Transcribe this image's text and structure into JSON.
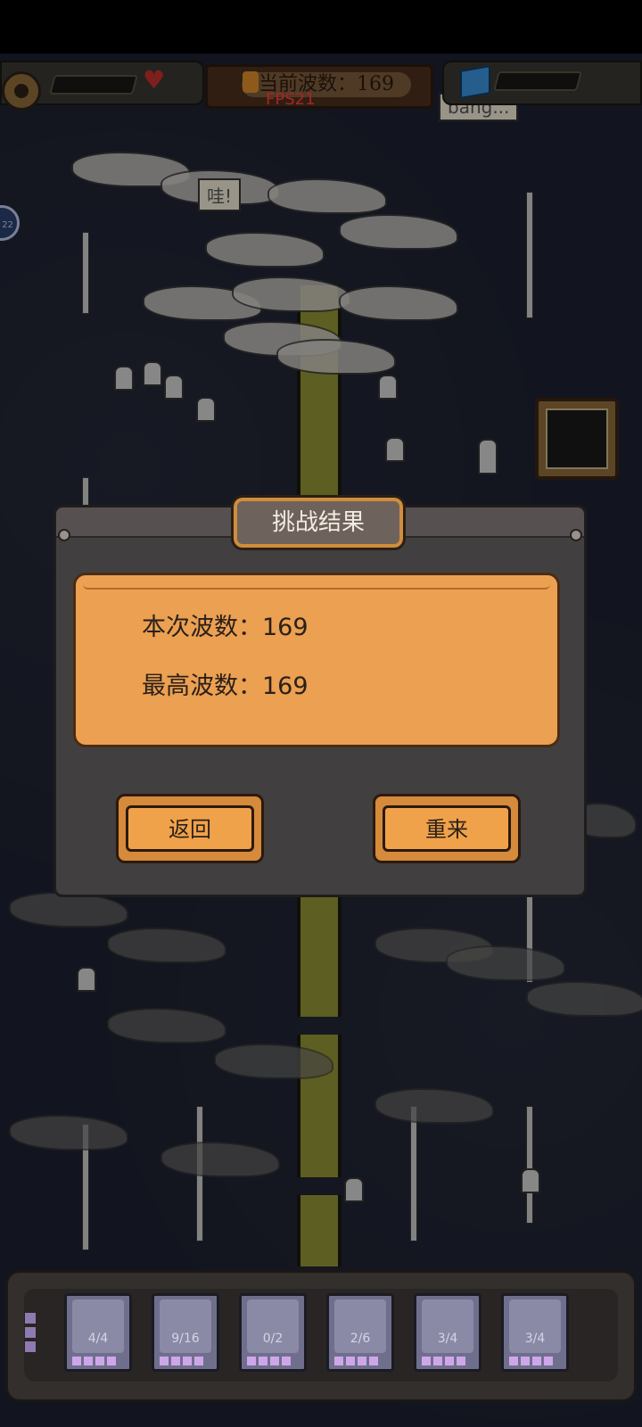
{
  "hud": {
    "wave_label": "当前波数：169",
    "fps": "FPS21",
    "side_badge": "22"
  },
  "world": {
    "bubble_top": "bang...",
    "bubble_wow": "哇!"
  },
  "dialog": {
    "title": "挑战结果",
    "current_wave_label": "本次波数：",
    "current_wave_value": "169",
    "best_wave_label": "最高波数：",
    "best_wave_value": "169",
    "back_button": "返回",
    "retry_button": "重来"
  },
  "cards": [
    {
      "count": "4/4"
    },
    {
      "count": "9/16"
    },
    {
      "count": "0/2"
    },
    {
      "count": "2/6"
    },
    {
      "count": "3/4"
    },
    {
      "count": "3/4"
    }
  ],
  "colors": {
    "accent_orange": "#f0a24b",
    "scroll_bg": "#eba052",
    "fps_red": "#ff3a3a"
  }
}
